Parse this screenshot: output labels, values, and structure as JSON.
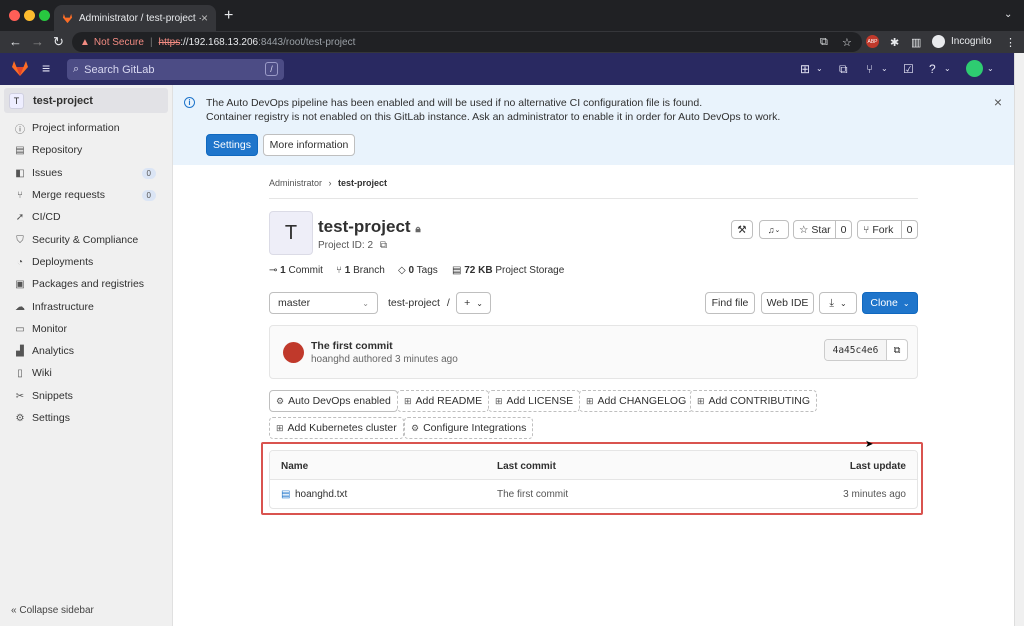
{
  "browser": {
    "tab_title": "Administrator / test-project · G",
    "tab_close": "×",
    "new_tab": "+",
    "security_label": "Not Secure",
    "url_scheme": "https",
    "url_host": "://192.168.13.206",
    "url_rest": ":8443/root/test-project",
    "incognito_label": "Incognito",
    "abp_badge": "ABP"
  },
  "gitlab_header": {
    "search_placeholder": "Search GitLab",
    "search_shortcut": "/"
  },
  "sidebar": {
    "project_avatar": "T",
    "project_name": "test-project",
    "items": [
      {
        "label": "Project information",
        "icon": "info-icon"
      },
      {
        "label": "Repository",
        "icon": "doc-icon"
      },
      {
        "label": "Issues",
        "icon": "issues-icon",
        "count": "0"
      },
      {
        "label": "Merge requests",
        "icon": "merge-icon",
        "count": "0"
      },
      {
        "label": "CI/CD",
        "icon": "rocket-icon"
      },
      {
        "label": "Security & Compliance",
        "icon": "shield-icon"
      },
      {
        "label": "Deployments",
        "icon": "deploy-icon"
      },
      {
        "label": "Packages and registries",
        "icon": "package-icon"
      },
      {
        "label": "Infrastructure",
        "icon": "cloud-icon"
      },
      {
        "label": "Monitor",
        "icon": "monitor-icon"
      },
      {
        "label": "Analytics",
        "icon": "chart-icon"
      },
      {
        "label": "Wiki",
        "icon": "book-icon"
      },
      {
        "label": "Snippets",
        "icon": "scissors-icon"
      },
      {
        "label": "Settings",
        "icon": "gear-icon"
      }
    ],
    "collapse_label": "Collapse sidebar"
  },
  "banner": {
    "line1": "The Auto DevOps pipeline has been enabled and will be used if no alternative CI configuration file is found.",
    "line2": "Container registry is not enabled on this GitLab instance. Ask an administrator to enable it in order for Auto DevOps to work.",
    "settings_button": "Settings",
    "more_info_button": "More information"
  },
  "breadcrumb": {
    "parent": "Administrator",
    "separator": "›",
    "current": "test-project"
  },
  "project": {
    "avatar_letter": "T",
    "title": "test-project",
    "id_label": "Project ID: 2",
    "star_label": "Star",
    "star_count": "0",
    "fork_label": "Fork",
    "fork_count": "0",
    "commits_count": "1",
    "commits_label": "Commit",
    "branches_count": "1",
    "branches_label": "Branch",
    "tags_count": "0",
    "tags_label": "Tags",
    "storage_size": "72 KB",
    "storage_label": "Project Storage"
  },
  "repo_toolbar": {
    "branch": "master",
    "path": "test-project",
    "path_sep": "/",
    "add_symbol": "+",
    "find_file": "Find file",
    "web_ide": "Web IDE",
    "clone": "Clone"
  },
  "last_commit": {
    "title": "The first commit",
    "author": "hoanghd",
    "meta": "authored 3 minutes ago",
    "sha": "4a45c4e6"
  },
  "quick_actions": [
    {
      "label": "Auto DevOps enabled",
      "icon": "gear-icon"
    },
    {
      "label": "Add README",
      "icon": "plus-square-icon"
    },
    {
      "label": "Add LICENSE",
      "icon": "plus-square-icon"
    },
    {
      "label": "Add CHANGELOG",
      "icon": "plus-square-icon"
    },
    {
      "label": "Add CONTRIBUTING",
      "icon": "plus-square-icon"
    },
    {
      "label": "Add Kubernetes cluster",
      "icon": "plus-square-icon"
    },
    {
      "label": "Configure Integrations",
      "icon": "gear-icon"
    }
  ],
  "file_table": {
    "headers": [
      "Name",
      "Last commit",
      "Last update"
    ],
    "rows": [
      {
        "name": "hoanghd.txt",
        "last_commit": "The first commit",
        "last_update": "3 minutes ago"
      }
    ]
  },
  "colors": {
    "gitlab_header": "#292961",
    "primary": "#1f75cb",
    "highlight_box": "#d9534f",
    "banner_bg": "#e9f3fc"
  }
}
